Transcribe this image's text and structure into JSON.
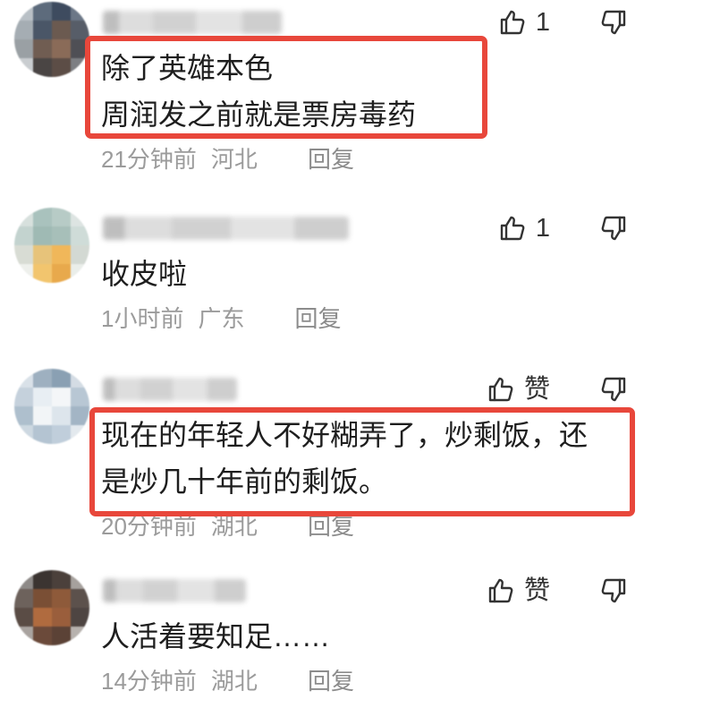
{
  "highlight_color": "#e8473b",
  "icons": {
    "like": "thumbs-up-icon",
    "dislike": "thumbs-down-icon"
  },
  "comments": [
    {
      "likes_label": "1",
      "text_lines": [
        "除了英雄本色",
        "周润发之前就是票房毒药"
      ],
      "time": "21分钟前",
      "location": "河北",
      "reply_label": "回复"
    },
    {
      "likes_label": "1",
      "text_lines": [
        "收皮啦"
      ],
      "time": "1小时前",
      "location": "广东",
      "reply_label": "回复"
    },
    {
      "likes_label": "赞",
      "text_lines": [
        "现在的年轻人不好糊弄了，炒剩饭，还",
        "是炒几十年前的剩饭。"
      ],
      "time": "20分钟前",
      "location": "湖北",
      "reply_label": "回复"
    },
    {
      "likes_label": "赞",
      "text_lines": [
        "人活着要知足……"
      ],
      "time": "14分钟前",
      "location": "湖北",
      "reply_label": "回复"
    }
  ]
}
